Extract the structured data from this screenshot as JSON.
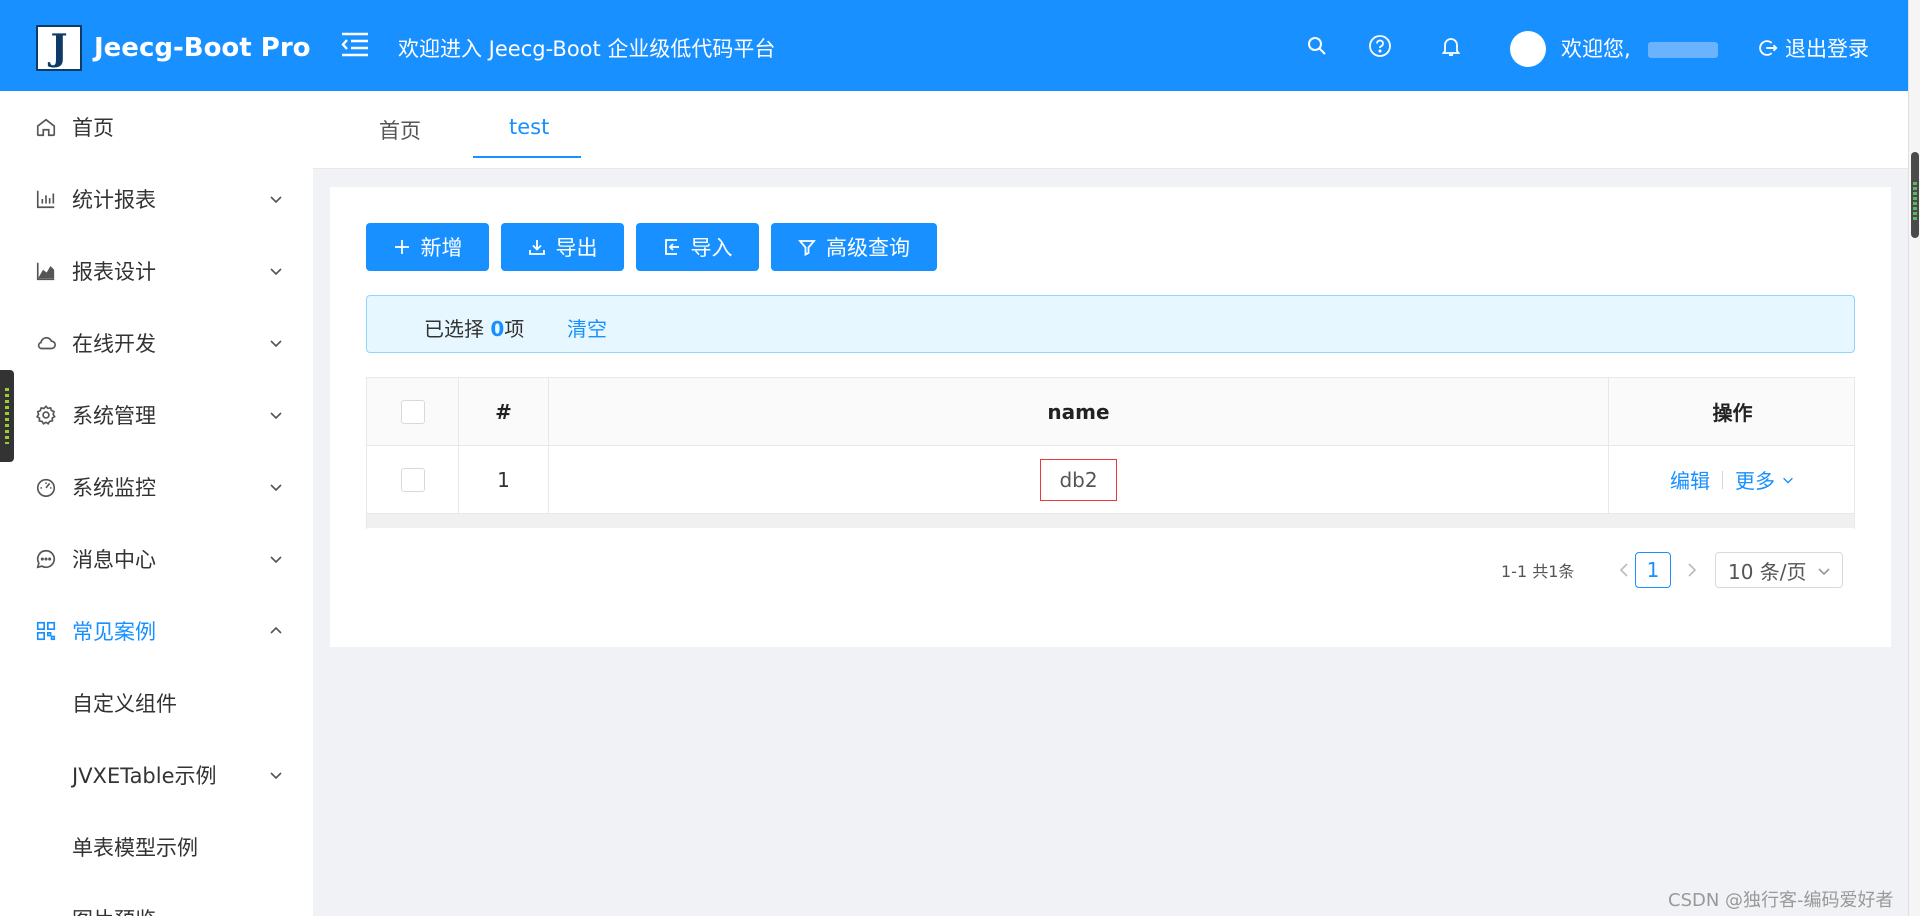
{
  "header": {
    "logo_letter": "J",
    "app_title": "Jeecg-Boot Pro",
    "welcome_message": "欢迎进入 Jeecg-Boot 企业级低代码平台",
    "user_greeting": "欢迎您,",
    "logout_label": "退出登录"
  },
  "sidebar": {
    "items": [
      {
        "label": "首页",
        "icon": "home-icon"
      },
      {
        "label": "统计报表",
        "icon": "bar-chart-icon"
      },
      {
        "label": "报表设计",
        "icon": "area-chart-icon"
      },
      {
        "label": "在线开发",
        "icon": "cloud-icon"
      },
      {
        "label": "系统管理",
        "icon": "gear-icon"
      },
      {
        "label": "系统监控",
        "icon": "dashboard-icon"
      },
      {
        "label": "消息中心",
        "icon": "message-icon"
      },
      {
        "label": "常见案例",
        "icon": "qrcode-icon"
      },
      {
        "label": "自定义组件"
      },
      {
        "label": "JVXETable示例"
      },
      {
        "label": "单表模型示例"
      },
      {
        "label": "图片预览"
      }
    ]
  },
  "tabs": [
    {
      "label": "首页"
    },
    {
      "label": "test"
    }
  ],
  "toolbar": {
    "add_label": "新增",
    "export_label": "导出",
    "import_label": "导入",
    "query_label": "高级查询"
  },
  "selection": {
    "prefix": "已选择 ",
    "count": "0",
    "suffix": "项",
    "clear_label": "清空"
  },
  "table": {
    "columns": [
      "#",
      "name",
      "操作"
    ],
    "rows": [
      {
        "index": "1",
        "name": "db2",
        "edit_label": "编辑",
        "more_label": "更多"
      }
    ]
  },
  "pagination": {
    "total_text": "1-1 共1条",
    "current_page": "1",
    "page_size": "10 条/页"
  },
  "watermark": "CSDN @独行客-编码爱好者",
  "colors": {
    "primary": "#1890ff",
    "alert_bg": "#e6f7ff",
    "highlight_border": "#e8383d"
  }
}
